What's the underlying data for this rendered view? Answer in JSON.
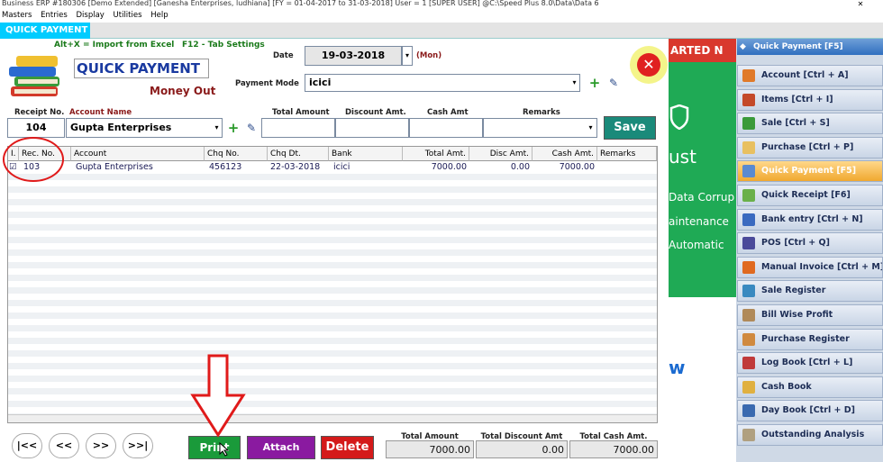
{
  "window": {
    "title": "Business ERP #180306 [Demo Extended] [Ganesha Enterprises, ludhiana] [FY = 01-04-2017 to 31-03-2018] User = 1 [SUPER USER] @C:\\Speed Plus 8.0\\Data\\Data 6",
    "close_label": "✕"
  },
  "menu": [
    "Masters",
    "Entries",
    "Display",
    "Utilities",
    "Help"
  ],
  "tab": {
    "label": "QUICK PAYMENT"
  },
  "form": {
    "shortcut_import": "Alt+X = Import from Excel",
    "shortcut_tab": "F12 - Tab Settings",
    "title": "QUICK PAYMENT",
    "subtitle": "Money Out",
    "date_label": "Date",
    "date_value": "19-03-2018",
    "day": "(Mon)",
    "payment_mode_label": "Payment Mode",
    "payment_mode_value": "icici",
    "receipt_no_label": "Receipt No.",
    "receipt_no_value": "104",
    "account_name_label": "Account Name",
    "account_name_value": "Gupta Enterprises",
    "total_amount_label": "Total Amount",
    "discount_amt_label": "Discount Amt.",
    "cash_amt_label": "Cash Amt",
    "remarks_label": "Remarks",
    "save_label": "Save"
  },
  "grid": {
    "columns": [
      "I.",
      "Rec. No.",
      "Account",
      "Chq No.",
      "Chq Dt.",
      "Bank",
      "Total Amt.",
      "Disc Amt.",
      "Cash Amt.",
      "Remarks"
    ],
    "rows": [
      {
        "checked": "☑",
        "rec_no": "103",
        "account": "Gupta Enterprises",
        "chq_no": "456123",
        "chq_dt": "22-03-2018",
        "bank": "icici",
        "total_amt": "7000.00",
        "disc_amt": "0.00",
        "cash_amt": "7000.00",
        "remarks": ""
      }
    ]
  },
  "footer": {
    "nav": [
      "|<<",
      "<<",
      ">>",
      ">>|"
    ],
    "print_label": "Print",
    "attach_label": "Attach",
    "delete_label": "Delete",
    "total_amount_label": "Total Amount",
    "total_amount_value": "7000.00",
    "total_discount_label": "Total Discount Amt",
    "total_discount_value": "0.00",
    "total_cash_label": "Total Cash Amt.",
    "total_cash_value": "7000.00"
  },
  "promo": {
    "banner": "ARTED N",
    "line1": "ust",
    "line2": "Data Corrup",
    "line3": "aintenance",
    "line4": "Automatic",
    "line5": "w"
  },
  "sidebar": {
    "header": "Quick Payment [F5]",
    "items": [
      {
        "label": "Account [Ctrl + A]",
        "icon_color": "#e07a2a"
      },
      {
        "label": "Items [Ctrl + I]",
        "icon_color": "#c44a2a"
      },
      {
        "label": "Sale [Ctrl + S]",
        "icon_color": "#3a9a3a"
      },
      {
        "label": "Purchase [Ctrl + P]",
        "icon_color": "#e8c060"
      },
      {
        "label": "Quick Payment [F5]",
        "icon_color": "#5a8ad0",
        "active": true
      },
      {
        "label": "Quick Receipt [F6]",
        "icon_color": "#6ab04a"
      },
      {
        "label": "Bank entry [Ctrl + N]",
        "icon_color": "#3a6ac0"
      },
      {
        "label": "POS [Ctrl + Q]",
        "icon_color": "#4a4a9a"
      },
      {
        "label": "Manual Invoice [Ctrl + M]",
        "icon_color": "#e06a20"
      },
      {
        "label": "Sale Register",
        "icon_color": "#3a8ac0"
      },
      {
        "label": "Bill Wise Profit",
        "icon_color": "#b08a5a"
      },
      {
        "label": "Purchase Register",
        "icon_color": "#d08a40"
      },
      {
        "label": "Log Book [Ctrl + L]",
        "icon_color": "#c03a3a"
      },
      {
        "label": "Cash Book",
        "icon_color": "#e0b040"
      },
      {
        "label": "Day Book [Ctrl + D]",
        "icon_color": "#3a6ab0"
      },
      {
        "label": "Outstanding Analysis",
        "icon_color": "#b0a080"
      }
    ]
  }
}
